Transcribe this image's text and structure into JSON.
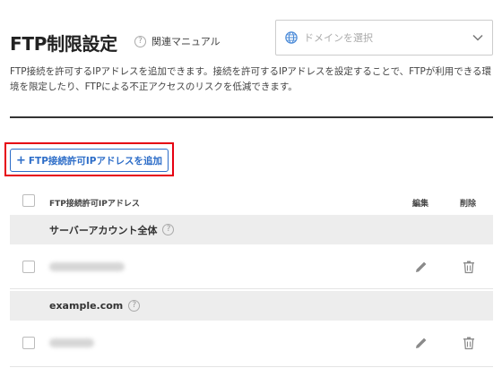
{
  "header": {
    "title": "FTP制限設定",
    "manual_label": "関連マニュアル"
  },
  "domain_select": {
    "placeholder": "ドメインを選択"
  },
  "description": "FTP接続を許可するIPアドレスを追加できます。接続を許可するIPアドレスを設定することで、FTPが利用できる環境を限定したり、FTPによる不正アクセスのリスクを低減できます。",
  "add_button": {
    "icon": "+",
    "label": "FTP接続許可IPアドレスを追加"
  },
  "table": {
    "columns": {
      "address": "FTP接続許可IPアドレス",
      "edit": "編集",
      "delete": "削除"
    },
    "groups": [
      {
        "label": "サーバーアカウント全体"
      },
      {
        "label": "example.com"
      }
    ]
  },
  "colors": {
    "accent": "#2d6dc8",
    "highlight": "#e60012",
    "group_bg": "#ededed"
  }
}
